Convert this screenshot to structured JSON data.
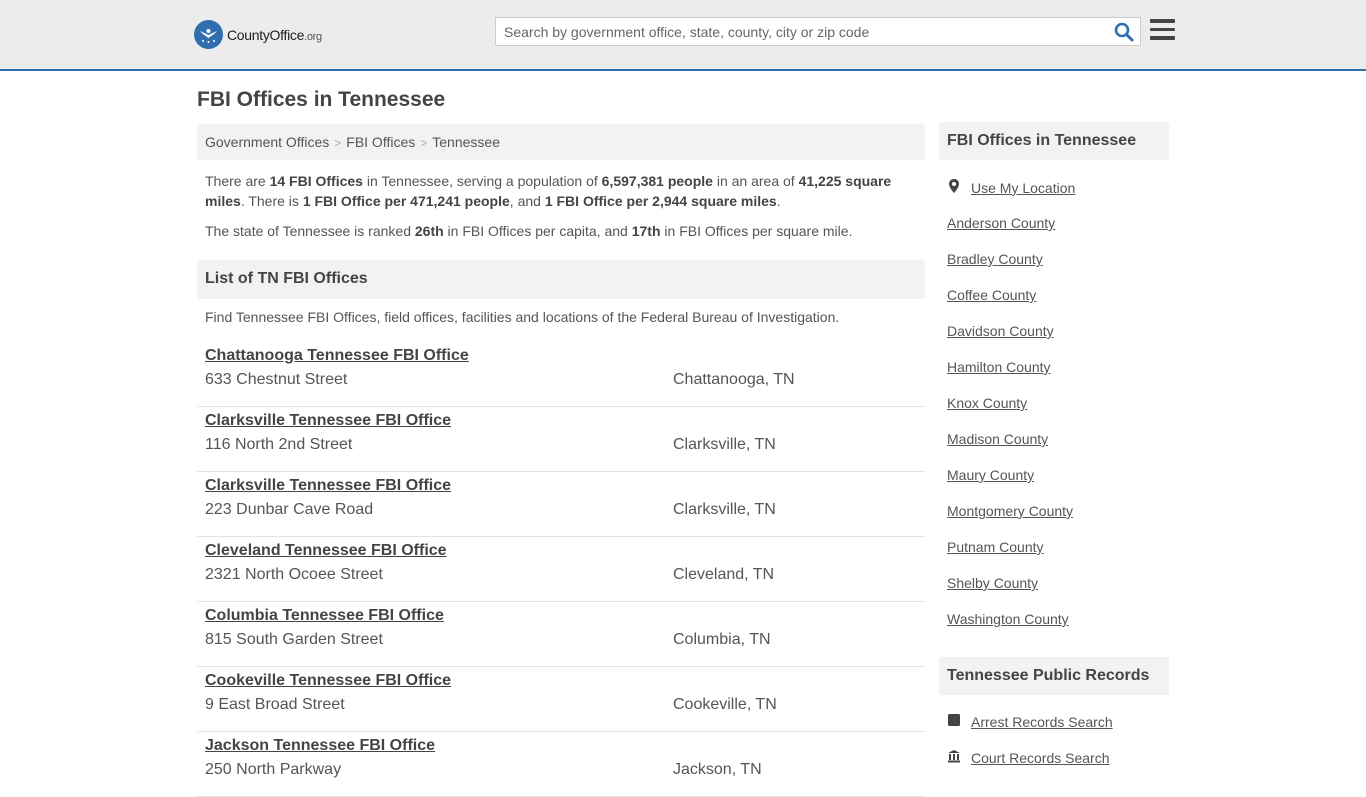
{
  "header": {
    "logo_main": "CountyOffice",
    "logo_tld": ".org",
    "search_placeholder": "Search by government office, state, county, city or zip code",
    "search_icon": "search-icon",
    "menu_icon": "hamburger-menu-icon",
    "accent_color": "#2f6fad"
  },
  "page": {
    "title": "FBI Offices in Tennessee",
    "breadcrumbs": [
      "Government Offices",
      "FBI Offices",
      "Tennessee"
    ],
    "intro": {
      "t1": "There are ",
      "count": "14 FBI Offices",
      "t2": " in Tennessee, serving a population of ",
      "population": "6,597,381 people",
      "t3": " in an area of ",
      "area": "41,225 square miles",
      "t4": ". There is ",
      "per_people": "1 FBI Office per 471,241 people",
      "t5": ", and ",
      "per_area": "1 FBI Office per 2,944 square miles",
      "t6": "."
    },
    "rank": {
      "t1": "The state of Tennessee is ranked ",
      "capita_rank": "26th",
      "t2": " in FBI Offices per capita, and ",
      "area_rank": "17th",
      "t3": " in FBI Offices per square mile."
    },
    "list_heading": "List of TN FBI Offices",
    "list_description": "Find Tennessee FBI Offices, field offices, facilities and locations of the Federal Bureau of Investigation.",
    "offices": [
      {
        "name": "Chattanooga Tennessee FBI Office",
        "address": "633 Chestnut Street",
        "city": "Chattanooga, TN"
      },
      {
        "name": "Clarksville Tennessee FBI Office",
        "address": "116 North 2nd Street",
        "city": "Clarksville, TN"
      },
      {
        "name": "Clarksville Tennessee FBI Office",
        "address": "223 Dunbar Cave Road",
        "city": "Clarksville, TN"
      },
      {
        "name": "Cleveland Tennessee FBI Office",
        "address": "2321 North Ocoee Street",
        "city": "Cleveland, TN"
      },
      {
        "name": "Columbia Tennessee FBI Office",
        "address": "815 South Garden Street",
        "city": "Columbia, TN"
      },
      {
        "name": "Cookeville Tennessee FBI Office",
        "address": "9 East Broad Street",
        "city": "Cookeville, TN"
      },
      {
        "name": "Jackson Tennessee FBI Office",
        "address": "250 North Parkway",
        "city": "Jackson, TN"
      }
    ]
  },
  "sidebar": {
    "heading": "FBI Offices in Tennessee",
    "use_location": "Use My Location",
    "counties": [
      "Anderson County",
      "Bradley County",
      "Coffee County",
      "Davidson County",
      "Hamilton County",
      "Knox County",
      "Madison County",
      "Maury County",
      "Montgomery County",
      "Putnam County",
      "Shelby County",
      "Washington County"
    ],
    "records_heading": "Tennessee Public Records",
    "records": [
      {
        "label": "Arrest Records Search",
        "icon": "arrest-record-icon"
      },
      {
        "label": "Court Records Search",
        "icon": "courthouse-icon"
      }
    ]
  }
}
